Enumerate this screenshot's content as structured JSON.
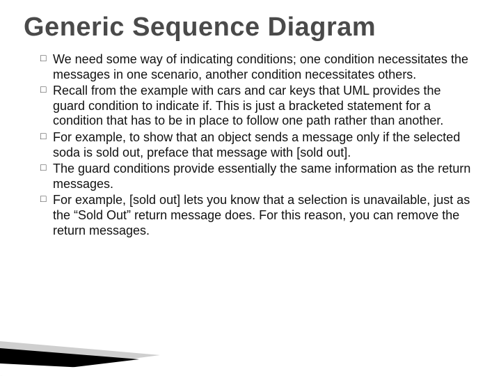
{
  "title": "Generic Sequence Diagram",
  "bullets": [
    "We need some way of indicating conditions; one condition necessitates the messages in one scenario, another condition necessitates others.",
    "Recall from the example with cars and car keys that UML provides the guard condition to indicate if. This is just a bracketed statement for a condition that has to be in place to follow one path rather than another.",
    "For example, to show that an object sends a message only if the selected soda is sold out, preface that message with [sold out].",
    "The guard conditions provide essentially the same information as the return messages.",
    "For example, [sold out] lets you know that a selection is unavailable, just as the “Sold Out” return message does. For this reason, you can remove the return messages."
  ]
}
